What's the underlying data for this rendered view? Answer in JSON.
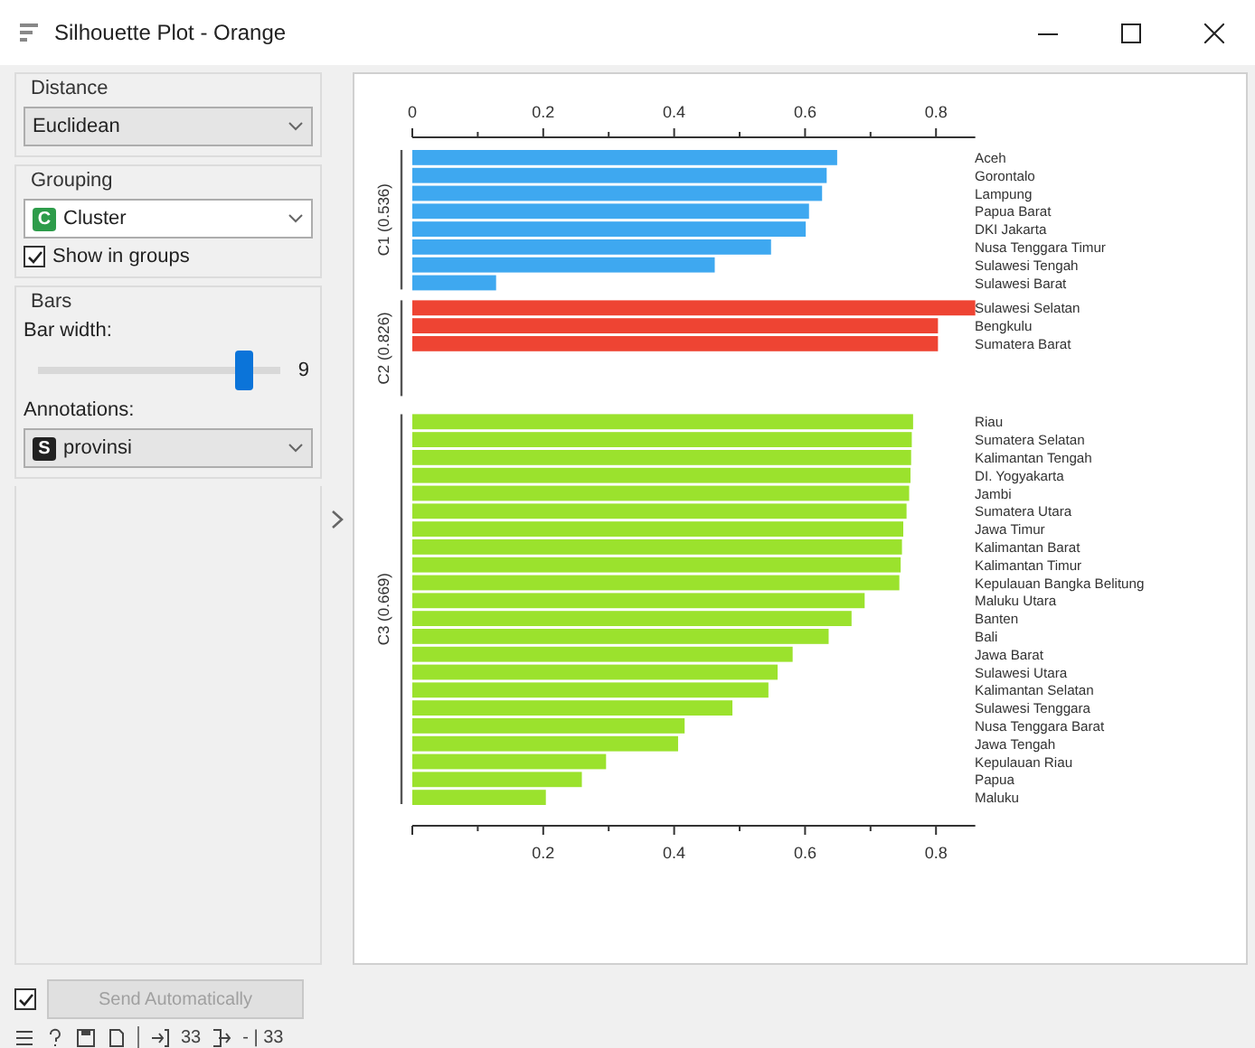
{
  "window": {
    "title": "Silhouette Plot - Orange"
  },
  "sidebar": {
    "distance": {
      "label": "Distance",
      "value": "Euclidean"
    },
    "grouping": {
      "label": "Grouping",
      "value": "Cluster",
      "badge": "C",
      "show_in_groups": {
        "label": "Show in groups",
        "checked": true
      }
    },
    "bars": {
      "label": "Bars",
      "bar_width": {
        "label": "Bar width:",
        "level": 0.85,
        "reading": "9"
      },
      "annotations": {
        "label": "Annotations:",
        "value": "provinsi",
        "badge": "S"
      }
    }
  },
  "plot": {
    "chart_data": {
      "type": "bar",
      "orientation": "horizontal",
      "xlim": [
        0,
        0.86
      ],
      "xticks": [
        0,
        0.2,
        0.4,
        0.6,
        0.8
      ],
      "categories": [
        "Aceh",
        "Gorontalo",
        "Lampung",
        "Papua Barat",
        "DKI Jakarta",
        "Nusa Tenggara Timur",
        "Sulawesi Tengah",
        "Sulawesi Barat",
        "Sulawesi Selatan",
        "Bengkulu",
        "Sumatera Barat",
        "Riau",
        "Sumatera Selatan",
        "Kalimantan Tengah",
        "DI. Yogyakarta",
        "Jambi",
        "Sumatera Utara",
        "Jawa Timur",
        "Kalimantan Barat",
        "Kalimantan Timur",
        "Kepulauan Bangka Belitung",
        "Maluku Utara",
        "Banten",
        "Bali",
        "Jawa Barat",
        "Sulawesi Utara",
        "Kalimantan Selatan",
        "Sulawesi Tenggara",
        "Nusa Tenggara Barat",
        "Jawa Tengah",
        "Kepulauan Riau",
        "Papua",
        "Maluku"
      ],
      "series": [
        {
          "name": "C1 (0.536)",
          "color": "#3ea8f0",
          "values": [
            0.649,
            0.633,
            0.626,
            0.606,
            0.601,
            0.548,
            0.462,
            0.128,
            null,
            null,
            null,
            null,
            null,
            null,
            null,
            null,
            null,
            null,
            null,
            null,
            null,
            null,
            null,
            null,
            null,
            null,
            null,
            null,
            null,
            null,
            null,
            null,
            null
          ]
        },
        {
          "name": "C2 (0.826)",
          "color": "#ee4433",
          "values": [
            null,
            null,
            null,
            null,
            null,
            null,
            null,
            null,
            0.86,
            0.803,
            0.803,
            null,
            null,
            null,
            null,
            null,
            null,
            null,
            null,
            null,
            null,
            null,
            null,
            null,
            null,
            null,
            null,
            null,
            null,
            null,
            null,
            null,
            null
          ]
        },
        {
          "name": "C3 (0.669)",
          "color": "#9be22d",
          "values": [
            null,
            null,
            null,
            null,
            null,
            null,
            null,
            null,
            null,
            null,
            null,
            0.765,
            0.763,
            0.762,
            0.761,
            0.759,
            0.755,
            0.75,
            0.748,
            0.746,
            0.744,
            0.691,
            0.671,
            0.636,
            0.581,
            0.558,
            0.544,
            0.489,
            0.416,
            0.406,
            0.296,
            0.259,
            0.204
          ]
        }
      ]
    },
    "bottom_axis_labels": [
      "0.2",
      "0.4",
      "0.6",
      "0.8"
    ]
  },
  "send": {
    "checked": true,
    "label": "Send Automatically",
    "disabled": true
  },
  "status_bar": {
    "input_count": "33",
    "output_count": "- | 33"
  }
}
